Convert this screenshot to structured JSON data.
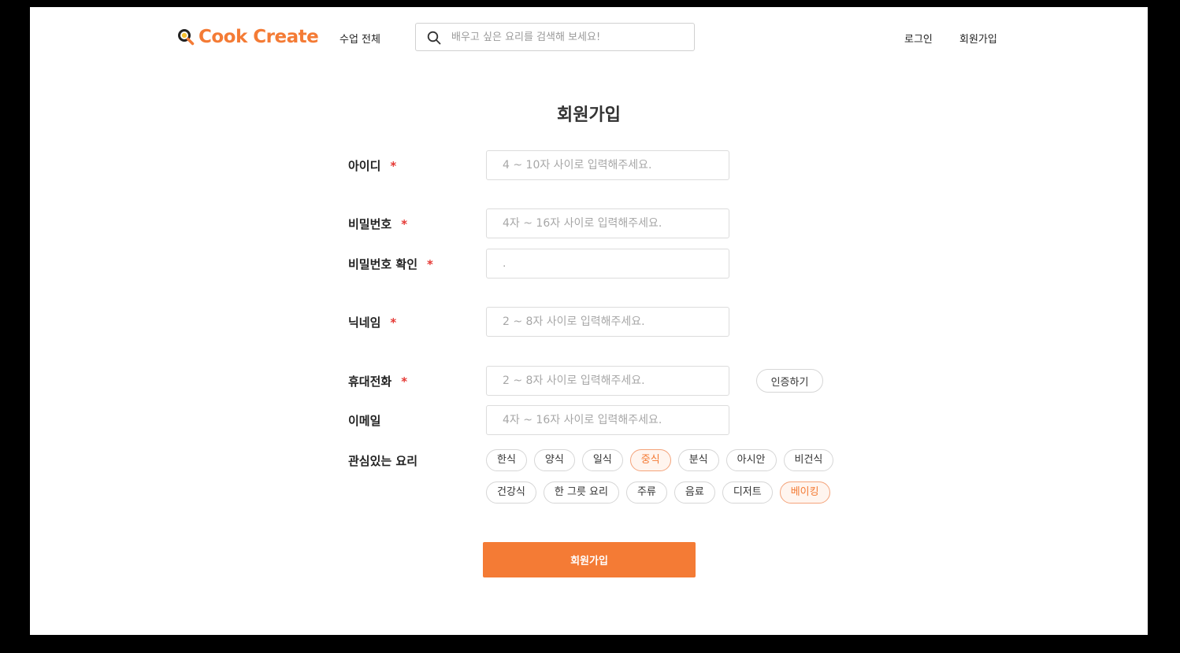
{
  "header": {
    "logo_text": "Cook Create",
    "nav_all": "수업 전체",
    "search_placeholder": "배우고 싶은 요리를 검색해 보세요!",
    "login": "로그인",
    "signup": "회원가입"
  },
  "form": {
    "title": "회원가입",
    "required_mark": "*",
    "fields": {
      "id": {
        "label": "아이디",
        "placeholder": "4 ~ 10자 사이로 입력해주세요."
      },
      "password": {
        "label": "비밀번호",
        "placeholder": "4자 ~ 16자 사이로 입력해주세요."
      },
      "password_confirm": {
        "label": "비밀번호 확인",
        "placeholder": "."
      },
      "nickname": {
        "label": "닉네임",
        "placeholder": "2 ~ 8자 사이로 입력해주세요."
      },
      "phone": {
        "label": "휴대전화",
        "placeholder": "2 ~ 8자 사이로 입력해주세요."
      },
      "email": {
        "label": "이메일",
        "placeholder": "4자 ~ 16자 사이로 입력해주세요."
      }
    },
    "verify_button": "인증하기",
    "interests": {
      "label": "관심있는 요리",
      "row1": [
        {
          "label": "한식",
          "selected": false
        },
        {
          "label": "양식",
          "selected": false
        },
        {
          "label": "일식",
          "selected": false
        },
        {
          "label": "중식",
          "selected": true
        },
        {
          "label": "분식",
          "selected": false
        },
        {
          "label": "아시안",
          "selected": false
        },
        {
          "label": "비건식",
          "selected": false
        }
      ],
      "row2": [
        {
          "label": "건강식",
          "selected": false
        },
        {
          "label": "한 그릇 요리",
          "selected": false
        },
        {
          "label": "주류",
          "selected": false
        },
        {
          "label": "음료",
          "selected": false
        },
        {
          "label": "디저트",
          "selected": false
        },
        {
          "label": "베이킹",
          "selected": true
        }
      ]
    },
    "submit": "회원가입"
  },
  "colors": {
    "accent": "#f47b35",
    "required": "#e53935",
    "chip_selected_bg": "#fff5ef",
    "chip_selected_border": "#f4a37a"
  }
}
